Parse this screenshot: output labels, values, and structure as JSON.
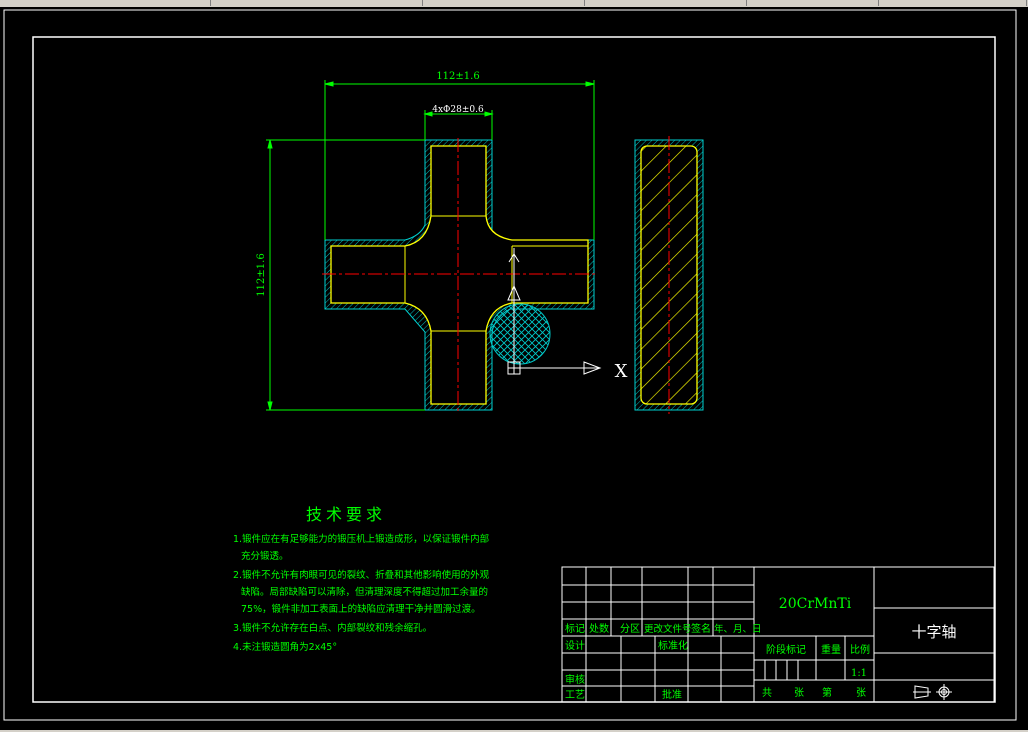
{
  "drawing": {
    "dims": {
      "overall_width": "112±1.6",
      "overall_height": "112±1.6",
      "journal_dia": "4xΦ28±0.6"
    },
    "view_label": "X",
    "requirements": {
      "title": "技术要求",
      "lines": [
        "1.锻件应在有足够能力的锻压机上锻造成形，以保证锻件内部",
        "充分锻透。",
        "2.锻件不允许有肉眼可见的裂纹、折叠和其他影响使用的外观",
        "缺陷。局部缺陷可以清除，但清理深度不得超过加工余量的",
        "75%，锻件非加工表面上的缺陷应清理干净并圆滑过渡。",
        "3.锻件不允许存在白点、内部裂纹和残余缩孔。",
        "4.未注锻造圆角为2x45°"
      ]
    },
    "title_block": {
      "material": "20CrMnTi",
      "part_name": "十字轴",
      "header_cells": [
        "标记",
        "处数",
        "分区",
        "更改文件号",
        "签名",
        "年、月、日"
      ],
      "design": "设计",
      "standardize": "标准化",
      "check": "审核",
      "process": "工艺",
      "approve": "批准",
      "stage_mark": "阶段标记",
      "weight": "重量",
      "scale_label": "比例",
      "scale": "1:1",
      "total": "共",
      "sheets": "张",
      "nth": "第",
      "sheet": "张"
    },
    "colors": {
      "background": "#000000",
      "outline": "#ffffff",
      "contour": "#ffff00",
      "dimension": "#00ff00",
      "centerline": "#ff0000",
      "hatch": "#00ffff",
      "text": "#00ff00"
    }
  }
}
